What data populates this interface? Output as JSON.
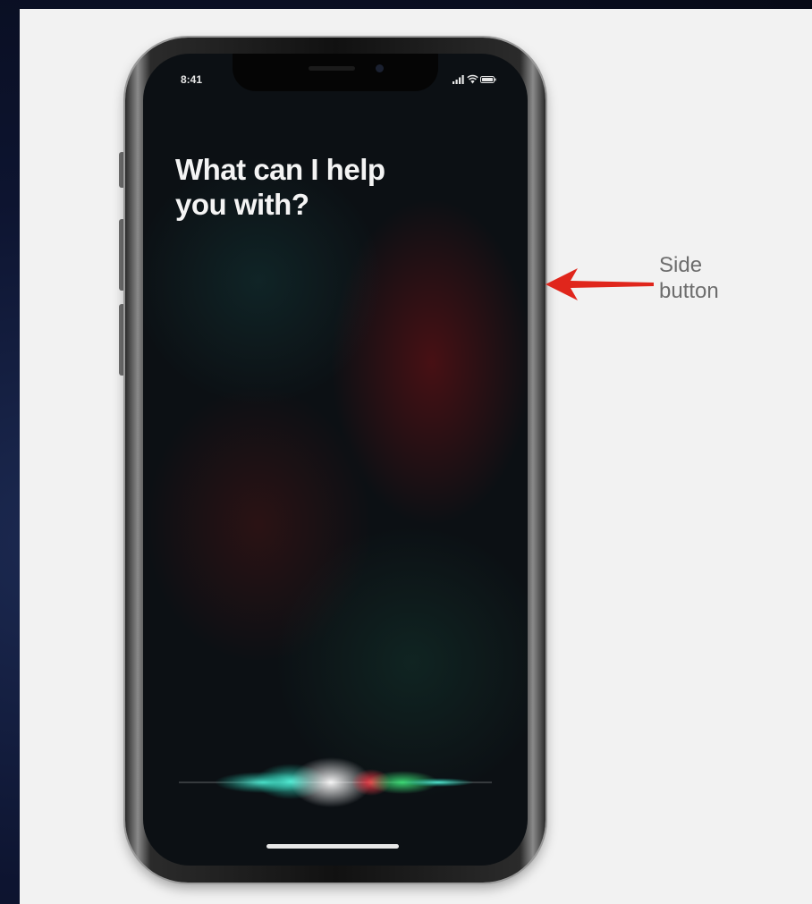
{
  "screen": {
    "status_time": "8:41",
    "prompt_line1": "What can I help",
    "prompt_line2": "you with?"
  },
  "callout": {
    "line1": "Side",
    "line2": "button",
    "arrow_color": "#e0261c"
  },
  "icons": {
    "signal": "signal-icon",
    "wifi": "wifi-icon",
    "battery": "battery-icon",
    "siri": "siri-wave-icon",
    "arrow": "arrow-left-icon"
  },
  "colors": {
    "background": "#f2f2f2",
    "frame": "#0b1122",
    "screen": "#0c1014",
    "text": "#f4f4f4",
    "label": "#6d6d6d"
  }
}
